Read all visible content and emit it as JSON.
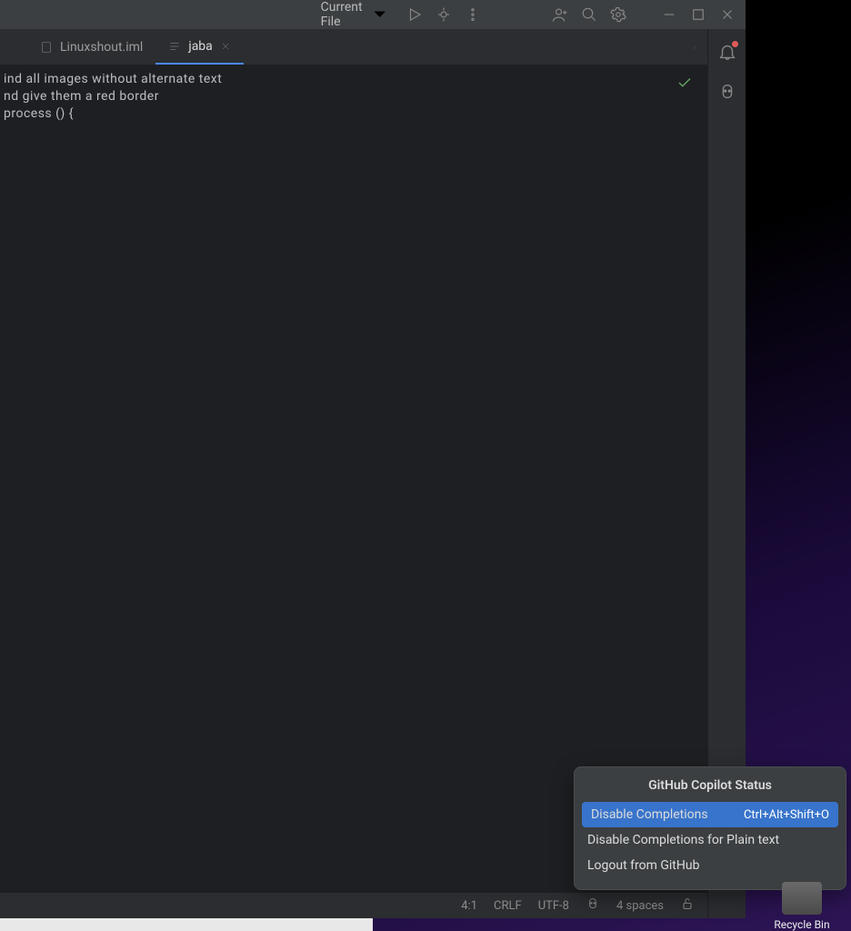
{
  "toolbar": {
    "runConfig": "Current File"
  },
  "tabs": [
    {
      "label": "Linuxshout.iml",
      "active": false
    },
    {
      "label": "jaba",
      "active": true
    }
  ],
  "editor": {
    "lines": [
      "ind all images without alternate text",
      "nd give them a red border",
      "process () {"
    ]
  },
  "statusbar": {
    "cursor": "4:1",
    "lineSep": "CRLF",
    "encoding": "UTF-8",
    "indent": "4 spaces"
  },
  "popup": {
    "title": "GitHub Copilot Status",
    "items": [
      {
        "label": "Disable Completions",
        "shortcut": "Ctrl+Alt+Shift+O",
        "highlight": true
      },
      {
        "label": "Disable Completions for Plain text",
        "shortcut": "",
        "highlight": false
      },
      {
        "label": "Logout from GitHub",
        "shortcut": "",
        "highlight": false
      }
    ]
  },
  "desktop": {
    "recycleBin": "Recycle Bin"
  }
}
